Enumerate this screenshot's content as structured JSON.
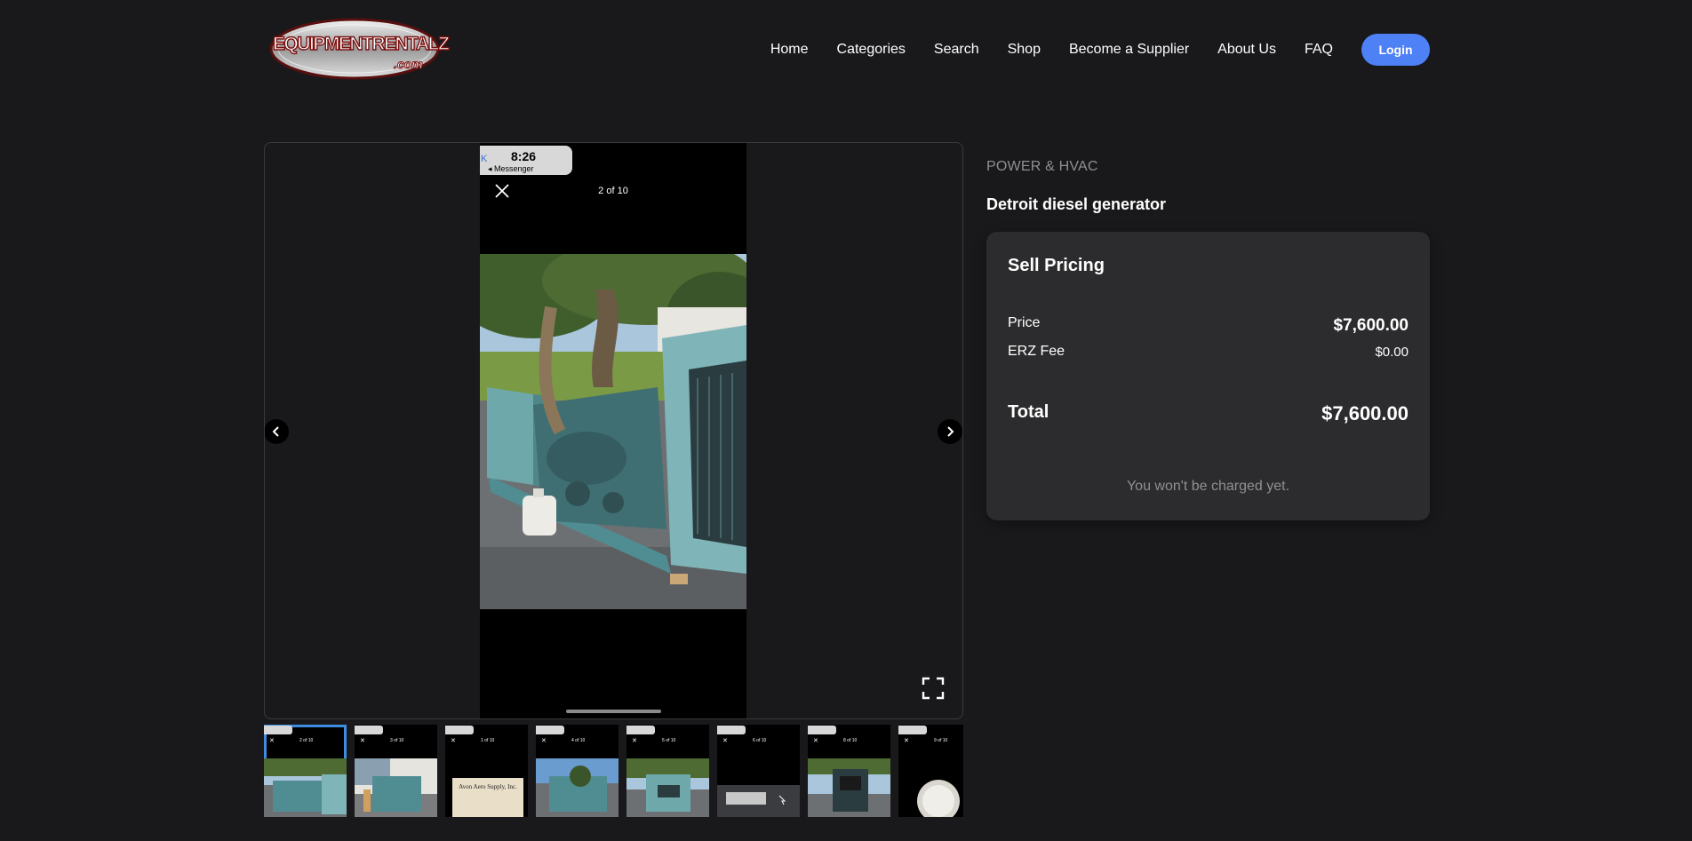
{
  "header": {
    "logo_text": "EQUIPMENTRENTALZ",
    "logo_subtext": ".com",
    "nav": [
      {
        "label": "Home"
      },
      {
        "label": "Categories"
      },
      {
        "label": "Search"
      },
      {
        "label": "Shop"
      },
      {
        "label": "Become a Supplier"
      },
      {
        "label": "About Us"
      },
      {
        "label": "FAQ"
      }
    ],
    "login_label": "Login"
  },
  "gallery": {
    "status_time": "8:26",
    "status_back": "◂ Messenger",
    "status_back_glyph": "K",
    "image_counter": "2 of 10",
    "icons": {
      "prev": "chevron-left-icon",
      "next": "chevron-right-icon",
      "fullscreen": "fullscreen-icon",
      "close": "close-icon"
    },
    "thumbnails": [
      {
        "counter": "2 of 10",
        "active": true
      },
      {
        "counter": "3 of 10",
        "active": false
      },
      {
        "counter": "1 of 10",
        "active": false
      },
      {
        "counter": "4 of 10",
        "active": false
      },
      {
        "counter": "5 of 10",
        "active": false
      },
      {
        "counter": "6 of 10",
        "active": false
      },
      {
        "counter": "8 of 10",
        "active": false
      },
      {
        "counter": "9 of 10",
        "active": false
      }
    ],
    "thumb_sign_text": "Avon Aero Supply, Inc."
  },
  "product": {
    "category": "POWER & HVAC",
    "title": "Detroit diesel generator"
  },
  "pricing": {
    "heading": "Sell Pricing",
    "price_label": "Price",
    "price_value": "$7,600.00",
    "fee_label": "ERZ Fee",
    "fee_value": "$0.00",
    "total_label": "Total",
    "total_value": "$7,600.00",
    "note": "You won't be charged yet."
  },
  "colors": {
    "background": "#19191b",
    "card": "#2c2c2e",
    "accent": "#4e80f6",
    "muted_text": "#8f8f94",
    "active_thumb": "#3f8de0"
  }
}
